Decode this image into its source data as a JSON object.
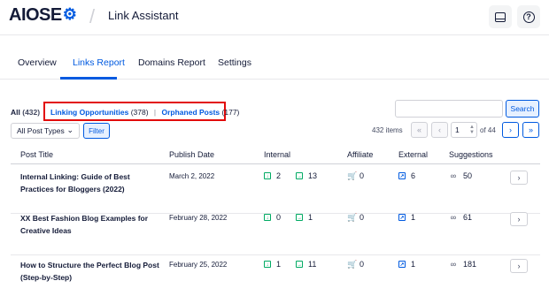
{
  "header": {
    "logo_main": "AIOSE",
    "logo_o": "O",
    "page_title": "Link Assistant",
    "icons": [
      "inbox-icon",
      "help-icon"
    ]
  },
  "tabs": [
    {
      "label": "Overview",
      "active": false
    },
    {
      "label": "Links Report",
      "active": true
    },
    {
      "label": "Domains Report",
      "active": false
    },
    {
      "label": "Settings",
      "active": false
    }
  ],
  "filters": {
    "all_label": "All",
    "all_count": "(432)",
    "opportunities_label": "Linking Opportunities",
    "opportunities_count": "(378)",
    "separator": "|",
    "orphaned_label": "Orphaned Posts",
    "orphaned_count": "(177)"
  },
  "search": {
    "placeholder": "",
    "button_label": "Search"
  },
  "post_type": {
    "selected": "All Post Types",
    "filter_button": "Filter"
  },
  "pagination": {
    "items": "432 items",
    "first": "«",
    "prev": "‹",
    "current_page": "1",
    "of": "of 44",
    "next": "›",
    "last": "»"
  },
  "table": {
    "headers": [
      "Post Title",
      "Publish Date",
      "Internal",
      "Affiliate",
      "External",
      "Suggestions"
    ],
    "rows": [
      {
        "title": "Internal Linking: Guide of Best Practices for Bloggers (2022)",
        "date": "March 2, 2022",
        "inbound": "2",
        "outbound": "13",
        "affiliate": "0",
        "external": "6",
        "suggestions": "50"
      },
      {
        "title": "XX Best Fashion Blog Examples for Creative Ideas",
        "date": "February 28, 2022",
        "inbound": "0",
        "outbound": "1",
        "affiliate": "0",
        "external": "1",
        "suggestions": "61"
      },
      {
        "title": "How to Structure the Perfect Blog Post (Step-by-Step)",
        "date": "February 25, 2022",
        "inbound": "1",
        "outbound": "11",
        "affiliate": "0",
        "external": "1",
        "suggestions": "181"
      }
    ],
    "row_button": "›"
  },
  "colors": {
    "accent": "#005ae0",
    "highlight": "#e20b0b",
    "internal": "#00aa63",
    "affiliate": "#f18200"
  }
}
